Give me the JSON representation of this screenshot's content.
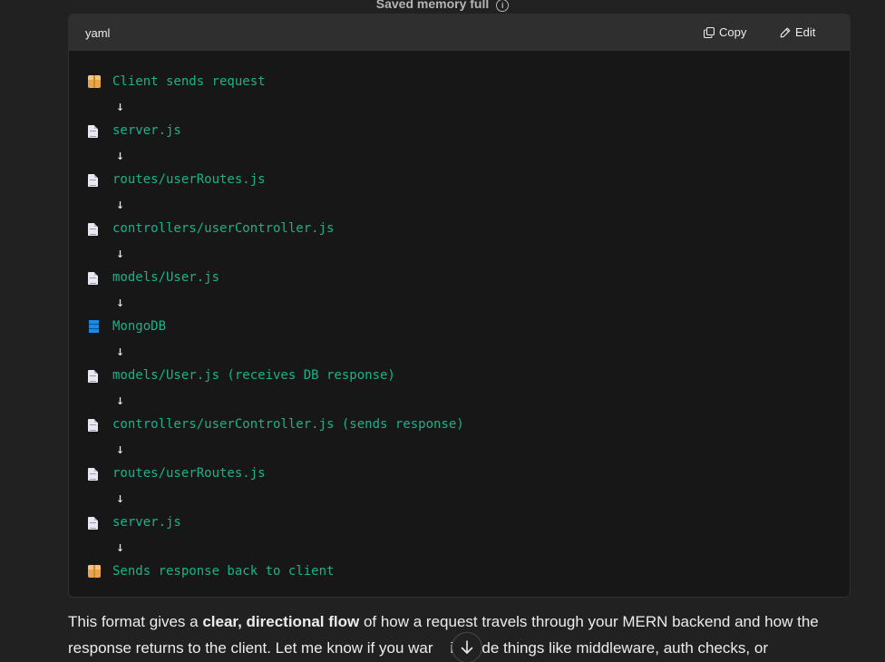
{
  "banner": {
    "text": "Saved memory full",
    "info_icon": "info-icon"
  },
  "code_block": {
    "language": "yaml",
    "copy_label": "Copy",
    "edit_label": "Edit",
    "lines": [
      {
        "icon": "package",
        "text": "Client sends request"
      },
      {
        "icon": "arrow",
        "text": "↓"
      },
      {
        "icon": "document",
        "text": "server.js"
      },
      {
        "icon": "arrow",
        "text": "↓"
      },
      {
        "icon": "document",
        "text": "routes/userRoutes.js"
      },
      {
        "icon": "arrow",
        "text": "↓"
      },
      {
        "icon": "document",
        "text": "controllers/userController.js"
      },
      {
        "icon": "arrow",
        "text": "↓"
      },
      {
        "icon": "document",
        "text": "models/User.js"
      },
      {
        "icon": "arrow",
        "text": "↓"
      },
      {
        "icon": "database",
        "text": "MongoDB"
      },
      {
        "icon": "arrow",
        "text": "↓"
      },
      {
        "icon": "document",
        "text": "models/User.js (receives DB response)"
      },
      {
        "icon": "arrow",
        "text": "↓"
      },
      {
        "icon": "document",
        "text": "controllers/userController.js (sends response)"
      },
      {
        "icon": "arrow",
        "text": "↓"
      },
      {
        "icon": "document",
        "text": "routes/userRoutes.js"
      },
      {
        "icon": "arrow",
        "text": "↓"
      },
      {
        "icon": "document",
        "text": "server.js"
      },
      {
        "icon": "arrow",
        "text": "↓"
      },
      {
        "icon": "package",
        "text": "Sends response back to client"
      }
    ]
  },
  "prose": {
    "line1_pre": "This format gives a ",
    "line1_bold": "clear, directional flow",
    "line1_post": " of how a request travels through your MERN backend and how the",
    "line2": "response returns to the client. Let me know if you war    include things like middleware, auth checks, or"
  },
  "colors": {
    "background": "#212121",
    "code_background": "#171717",
    "code_header": "#2f2f2f",
    "code_text": "#19b389"
  }
}
